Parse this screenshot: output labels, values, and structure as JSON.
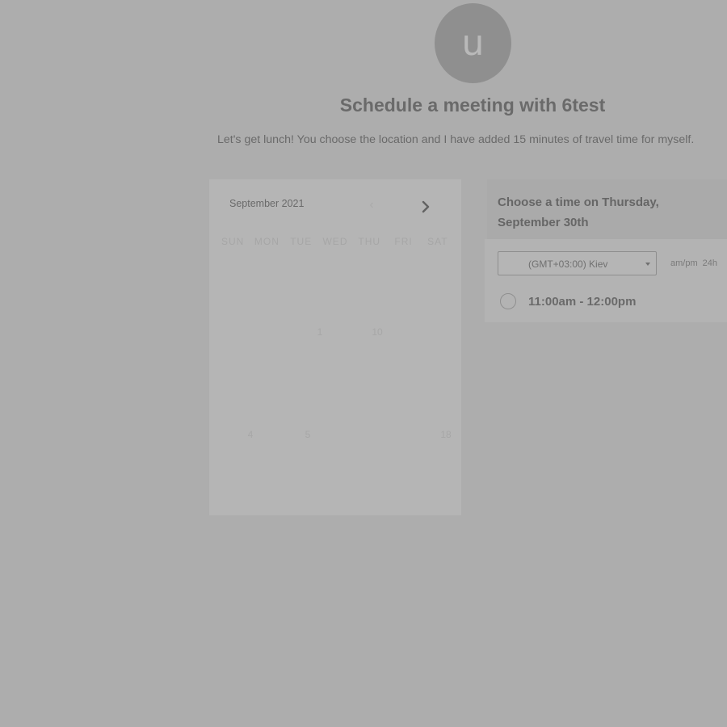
{
  "avatar": {
    "initial": "u"
  },
  "title": "Schedule a meeting with 6test",
  "description": "Let's get lunch! You choose the location and I have added 15 minutes of travel time for myself.",
  "calendar": {
    "month": "September 2021",
    "prev_icon": "chevron-left-icon",
    "next_icon": "chevron-right-icon",
    "weekdays": [
      "SUN",
      "MON",
      "TUE",
      "WED",
      "THU",
      "FRI",
      "SAT"
    ],
    "visible_days": [
      "1",
      "10",
      "4",
      "5",
      "18"
    ]
  },
  "time_picker": {
    "heading": "Choose a time on Thursday, September 30th",
    "timezone": "(GMT+03:00) Kiev",
    "format_options": [
      "am/pm",
      "24h"
    ],
    "slots": [
      {
        "label": "11:00am - 12:00pm"
      }
    ]
  },
  "colors": {
    "overlay_background": "#adadad",
    "panel": "#b5b5b5",
    "text": "#6a6a6a"
  }
}
